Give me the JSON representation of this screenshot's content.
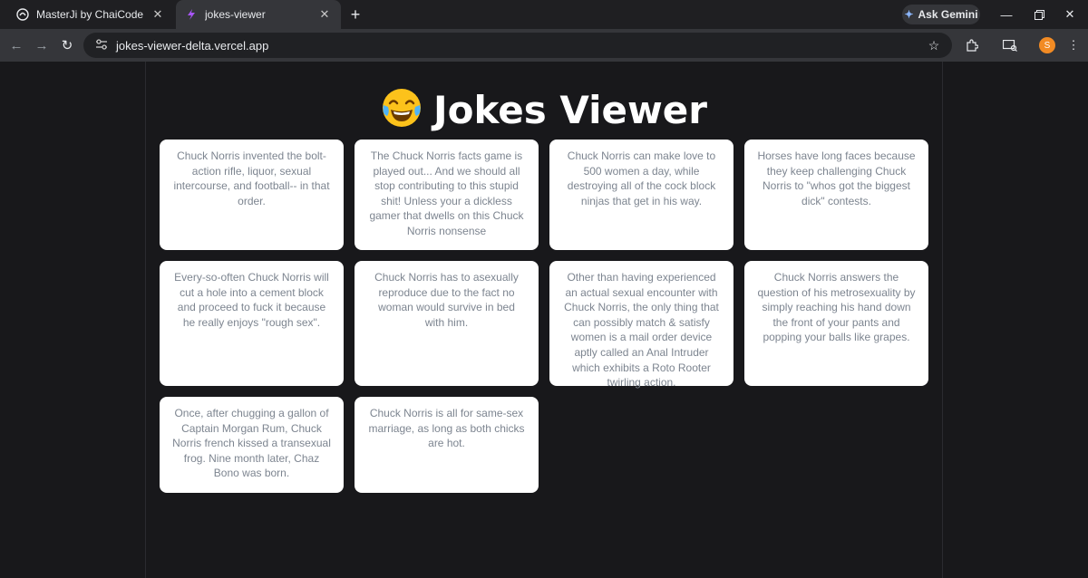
{
  "browser": {
    "tabs": [
      {
        "title": "MasterJi by ChaiCode",
        "icon": "chaicode-logo-icon",
        "active": false
      },
      {
        "title": "jokes-viewer",
        "icon": "vite-logo-icon",
        "active": true
      }
    ],
    "ask_gemini_label": "Ask Gemini",
    "url": "jokes-viewer-delta.vercel.app",
    "profile_initial": "S",
    "accent": "#f28b24"
  },
  "page": {
    "title": "Jokes Viewer",
    "jokes": [
      "Chuck Norris invented the bolt-action rifle, liquor, sexual intercourse, and football-- in that order.",
      "The Chuck Norris facts game is played out... And we should all stop contributing to this stupid shit! Unless your a dickless gamer that dwells on this Chuck Norris nonsense",
      "Chuck Norris can make love to 500 women a day, while destroying all of the cock block ninjas that get in his way.",
      "Horses have long faces because they keep challenging Chuck Norris to \"whos got the biggest dick\" contests.",
      "Every-so-often Chuck Norris will cut a hole into a cement block and proceed to fuck it because he really enjoys \"rough sex\".",
      "Chuck Norris has to asexually reproduce due to the fact no woman would survive in bed with him.",
      "Other than having experienced an actual sexual encounter with Chuck Norris, the only thing that can possibly match & satisfy women is a mail order device aptly called an Anal Intruder which exhibits a Roto Rooter twirling action.",
      "Chuck Norris answers the question of his metrosexuality by simply reaching his hand down the front of your pants and popping your balls like grapes.",
      "Once, after chugging a gallon of Captain Morgan Rum, Chuck Norris french kissed a transexual frog. Nine month later, Chaz Bono was born.",
      "Chuck Norris is all for same-sex marriage, as long as both chicks are hot."
    ]
  }
}
